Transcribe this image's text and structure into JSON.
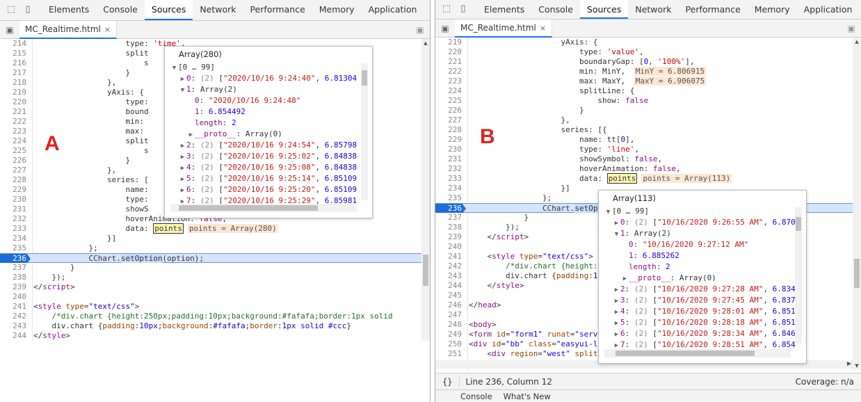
{
  "devtools_tabs": [
    "Elements",
    "Console",
    "Sources",
    "Network",
    "Performance",
    "Memory",
    "Application"
  ],
  "more_tabs": "»",
  "file_tab": {
    "name": "MC_Realtime.html",
    "close": "×"
  },
  "labels": {
    "a": "A",
    "b": "B"
  },
  "left_panel": {
    "lines": [
      {
        "n": "214",
        "html": "                    type: <span class=\"str\">'time'</span>,"
      },
      {
        "n": "215",
        "html": "                    split"
      },
      {
        "n": "216",
        "html": "                        s"
      },
      {
        "n": "217",
        "html": "                    }"
      },
      {
        "n": "218",
        "html": "                },"
      },
      {
        "n": "219",
        "html": "                yAxis: {"
      },
      {
        "n": "220",
        "html": "                    type:"
      },
      {
        "n": "221",
        "html": "                    bound"
      },
      {
        "n": "222",
        "html": "                    min: "
      },
      {
        "n": "223",
        "html": "                    max: "
      },
      {
        "n": "224",
        "html": "                    split"
      },
      {
        "n": "225",
        "html": "                        s"
      },
      {
        "n": "226",
        "html": "                    }"
      },
      {
        "n": "227",
        "html": "                },"
      },
      {
        "n": "228",
        "html": "                series: ["
      },
      {
        "n": "229",
        "html": "                    name:"
      },
      {
        "n": "230",
        "html": "                    type:"
      },
      {
        "n": "231",
        "html": "                    showS"
      },
      {
        "n": "232",
        "html": "                    hoverAnimation: <span class=\"kw\">false</span>,"
      },
      {
        "n": "233",
        "html": "                    data: <span class=\"boxhl\">points</span><span class=\"inl\">points = Array(280)</span>"
      },
      {
        "n": "234",
        "html": "                }]"
      },
      {
        "n": "235",
        "html": "            };"
      },
      {
        "n": "236",
        "html": "            CChart.<span class=\"sel\">setOption</span>(option);",
        "hl": true
      },
      {
        "n": "237",
        "html": "        }"
      },
      {
        "n": "238",
        "html": "    });"
      },
      {
        "n": "239",
        "html": "&lt;/<span class=\"tag\">script</span>&gt;"
      },
      {
        "n": "240",
        "html": ""
      },
      {
        "n": "241",
        "html": "&lt;<span class=\"tag\">style</span> <span class=\"attr\">type</span>=<span class=\"num\">\"text/css\"</span>&gt;"
      },
      {
        "n": "242",
        "html": "    <span class=\"cmt\">/*div.chart {height:250px;padding:10px;background:#fafafa;border:1px solid</span>"
      },
      {
        "n": "243",
        "html": "    div.chart {<span class=\"attr\">padding</span>:<span class=\"num\">10px</span>;<span class=\"attr\">background</span>:<span class=\"num\">#fafafa</span>;<span class=\"attr\">border</span>:<span class=\"num\">1px solid #ccc</span>}"
      },
      {
        "n": "244",
        "html": "&lt;/<span class=\"tag\">style</span>&gt;"
      }
    ],
    "popup": {
      "title": "Array(280)",
      "rows": [
        {
          "i": 0,
          "tri": "▼",
          "html": "[0 … 99]"
        },
        {
          "i": 1,
          "tri": "▶",
          "html": "<span class=\"pidx\">0</span>: <span class=\"pgray\">(2)</span> [<span class=\"pstr\">\"2020/10/16 9:24:40\"</span>, <span class=\"pnum\">6.81304</span>"
        },
        {
          "i": 1,
          "tri": "▼",
          "html": "<span class=\"pidx\">1</span>: Array(2)"
        },
        {
          "i": 2,
          "tri": "",
          "html": "<span class=\"pidx\">0</span>: <span class=\"pstr\">\"2020/10/16 9:24:48\"</span>"
        },
        {
          "i": 2,
          "tri": "",
          "html": "<span class=\"pidx\">1</span>: <span class=\"pnum\">6.854492</span>"
        },
        {
          "i": 2,
          "tri": "",
          "html": "<span class=\"pk\">length</span>: <span class=\"pnum\">2</span>"
        },
        {
          "i": 2,
          "tri": "▶",
          "html": "<span class=\"pk\">__proto__</span>: Array(0)"
        },
        {
          "i": 1,
          "tri": "▶",
          "html": "<span class=\"pidx\">2</span>: <span class=\"pgray\">(2)</span> [<span class=\"pstr\">\"2020/10/16 9:24:54\"</span>, <span class=\"pnum\">6.85798</span>"
        },
        {
          "i": 1,
          "tri": "▶",
          "html": "<span class=\"pidx\">3</span>: <span class=\"pgray\">(2)</span> [<span class=\"pstr\">\"2020/10/16 9:25:02\"</span>, <span class=\"pnum\">6.84838</span>"
        },
        {
          "i": 1,
          "tri": "▶",
          "html": "<span class=\"pidx\">4</span>: <span class=\"pgray\">(2)</span> [<span class=\"pstr\">\"2020/10/16 9:25:08\"</span>, <span class=\"pnum\">6.84838</span>"
        },
        {
          "i": 1,
          "tri": "▶",
          "html": "<span class=\"pidx\">5</span>: <span class=\"pgray\">(2)</span> [<span class=\"pstr\">\"2020/10/16 9:25:14\"</span>, <span class=\"pnum\">6.85109</span>"
        },
        {
          "i": 1,
          "tri": "▶",
          "html": "<span class=\"pidx\">6</span>: <span class=\"pgray\">(2)</span> [<span class=\"pstr\">\"2020/10/16 9:25:20\"</span>, <span class=\"pnum\">6.85109</span>"
        },
        {
          "i": 1,
          "tri": "▶",
          "html": "<span class=\"pidx\">7</span>: <span class=\"pgray\">(2)</span> [<span class=\"pstr\">\"2020/10/16 9:25:29\"</span>, <span class=\"pnum\">6.85981</span>"
        }
      ]
    }
  },
  "right_panel": {
    "lines": [
      {
        "n": "219",
        "html": "                    yAxis: {"
      },
      {
        "n": "220",
        "html": "                        type: <span class=\"str\">'value'</span>,"
      },
      {
        "n": "221",
        "html": "                        boundaryGap: [<span class=\"num\">0</span>, <span class=\"str\">'100%'</span>],"
      },
      {
        "n": "222",
        "html": "                        min: MinY, <span class=\"inl\">MinY = 6.806915</span>"
      },
      {
        "n": "223",
        "html": "                        max: MaxY, <span class=\"inl\">MaxY = 6.906075</span>"
      },
      {
        "n": "224",
        "html": "                        splitLine: {"
      },
      {
        "n": "225",
        "html": "                            show: <span class=\"kw\">false</span>"
      },
      {
        "n": "226",
        "html": "                        }"
      },
      {
        "n": "227",
        "html": "                    },"
      },
      {
        "n": "228",
        "html": "                    series: [{"
      },
      {
        "n": "229",
        "html": "                        name: tt[<span class=\"num\">0</span>],"
      },
      {
        "n": "230",
        "html": "                        type: <span class=\"str\">'line'</span>,"
      },
      {
        "n": "231",
        "html": "                        showSymbol: <span class=\"kw\">false</span>,"
      },
      {
        "n": "232",
        "html": "                        hoverAnimation: <span class=\"kw\">false</span>,"
      },
      {
        "n": "233",
        "html": "                        data: <span class=\"boxhl\">points</span><span class=\"inl\">points = Array(113)</span>"
      },
      {
        "n": "234",
        "html": "                    }]"
      },
      {
        "n": "235",
        "html": "                };"
      },
      {
        "n": "236",
        "html": "                CChart.<span class=\"sel\">setOpti</span>",
        "hl": true
      },
      {
        "n": "237",
        "html": "            }"
      },
      {
        "n": "238",
        "html": "        });"
      },
      {
        "n": "239",
        "html": "    &lt;/<span class=\"tag\">script</span>&gt;"
      },
      {
        "n": "240",
        "html": ""
      },
      {
        "n": "241",
        "html": "    &lt;<span class=\"tag\">style</span> <span class=\"attr\">type</span>=<span class=\"num\">\"text/css\"</span>&gt;"
      },
      {
        "n": "242",
        "html": "        <span class=\"cmt\">/*div.chart {height:2</span>                                  <span class=\"cmt\">px solid</span>"
      },
      {
        "n": "243",
        "html": "        div.chart {<span class=\"attr\">padding</span>:<span class=\"num\">10</span>"
      },
      {
        "n": "244",
        "html": "    &lt;/<span class=\"tag\">style</span>&gt;"
      },
      {
        "n": "245",
        "html": ""
      },
      {
        "n": "246",
        "html": "&lt;/<span class=\"tag\">head</span>&gt;"
      },
      {
        "n": "247",
        "html": ""
      },
      {
        "n": "248",
        "html": "&lt;<span class=\"tag\">body</span>&gt;"
      },
      {
        "n": "249",
        "html": "&lt;<span class=\"tag\">form</span> <span class=\"attr\">id</span>=<span class=\"num\">\"form1\"</span> <span class=\"attr\">runat</span>=<span class=\"num\">\"serve</span>"
      },
      {
        "n": "250",
        "html": "&lt;<span class=\"tag\">div</span> <span class=\"attr\">id</span>=<span class=\"num\">\"bb\"</span> <span class=\"attr\">class</span>=<span class=\"num\">\"easyui-la</span>"
      },
      {
        "n": "251",
        "html": "    &lt;<span class=\"tag\">div</span> <span class=\"attr\">region</span>=<span class=\"num\">\"west\"</span> <span class=\"attr\">split</span>="
      },
      {
        "n": "252",
        "html": ""
      }
    ],
    "popup": {
      "title": "Array(113)",
      "rows": [
        {
          "i": 0,
          "tri": "▼",
          "html": "[0 … 99]"
        },
        {
          "i": 1,
          "tri": "▶",
          "html": "<span class=\"pidx\">0</span>: <span class=\"pgray\">(2)</span> [<span class=\"pstr\">\"10/16/2020 9:26:55 AM\"</span>, <span class=\"pnum\">6.870</span>"
        },
        {
          "i": 1,
          "tri": "▼",
          "html": "<span class=\"pidx\">1</span>: Array(2)"
        },
        {
          "i": 2,
          "tri": "",
          "html": "<span class=\"pidx\">0</span>: <span class=\"pstr\">\"10/16/2020 9:27:12 AM\"</span>"
        },
        {
          "i": 2,
          "tri": "",
          "html": "<span class=\"pidx\">1</span>: <span class=\"pnum\">6.885262</span>"
        },
        {
          "i": 2,
          "tri": "",
          "html": "<span class=\"pk\">length</span>: <span class=\"pnum\">2</span>"
        },
        {
          "i": 2,
          "tri": "▶",
          "html": "<span class=\"pk\">__proto__</span>: Array(0)"
        },
        {
          "i": 1,
          "tri": "▶",
          "html": "<span class=\"pidx\">2</span>: <span class=\"pgray\">(2)</span> [<span class=\"pstr\">\"10/16/2020 9:27:28 AM\"</span>, <span class=\"pnum\">6.834</span>"
        },
        {
          "i": 1,
          "tri": "▶",
          "html": "<span class=\"pidx\">3</span>: <span class=\"pgray\">(2)</span> [<span class=\"pstr\">\"10/16/2020 9:27:45 AM\"</span>, <span class=\"pnum\">6.837</span>"
        },
        {
          "i": 1,
          "tri": "▶",
          "html": "<span class=\"pidx\">4</span>: <span class=\"pgray\">(2)</span> [<span class=\"pstr\">\"10/16/2020 9:28:01 AM\"</span>, <span class=\"pnum\">6.851</span>"
        },
        {
          "i": 1,
          "tri": "▶",
          "html": "<span class=\"pidx\">5</span>: <span class=\"pgray\">(2)</span> [<span class=\"pstr\">\"10/16/2020 9:28:18 AM\"</span>, <span class=\"pnum\">6.851</span>"
        },
        {
          "i": 1,
          "tri": "▶",
          "html": "<span class=\"pidx\">6</span>: <span class=\"pgray\">(2)</span> [<span class=\"pstr\">\"10/16/2020 9:28:34 AM\"</span>, <span class=\"pnum\">6.846</span>"
        },
        {
          "i": 1,
          "tri": "▶",
          "html": "<span class=\"pidx\">7</span>: <span class=\"pgray\">(2)</span> [<span class=\"pstr\">\"10/16/2020 9:28:51 AM\"</span>, <span class=\"pnum\">6.854</span>"
        }
      ]
    },
    "status": {
      "braces": "{}",
      "position": "Line 236, Column 12",
      "coverage": "Coverage: n/a"
    },
    "drawer_tabs": [
      "Console",
      "What's New"
    ]
  }
}
